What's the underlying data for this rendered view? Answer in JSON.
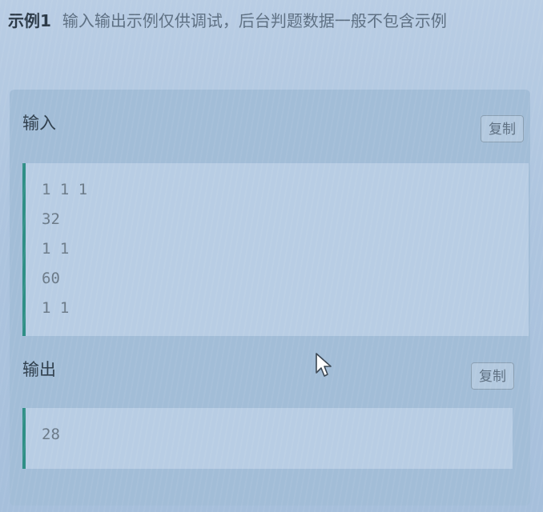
{
  "example": {
    "title": "示例1",
    "note": "输入输出示例仅供调试，后台判题数据一般不包含示例"
  },
  "input_section": {
    "label": "输入",
    "copy_label": "复制",
    "lines": [
      "1 1 1",
      "32",
      "1 1",
      "60",
      "1 1"
    ]
  },
  "output_section": {
    "label": "输出",
    "copy_label": "复制",
    "lines": [
      "28"
    ]
  },
  "colors": {
    "accent_bar": "#2f8f86",
    "background": "#aec5df"
  },
  "icons": {
    "cursor": "mouse-pointer-icon"
  }
}
